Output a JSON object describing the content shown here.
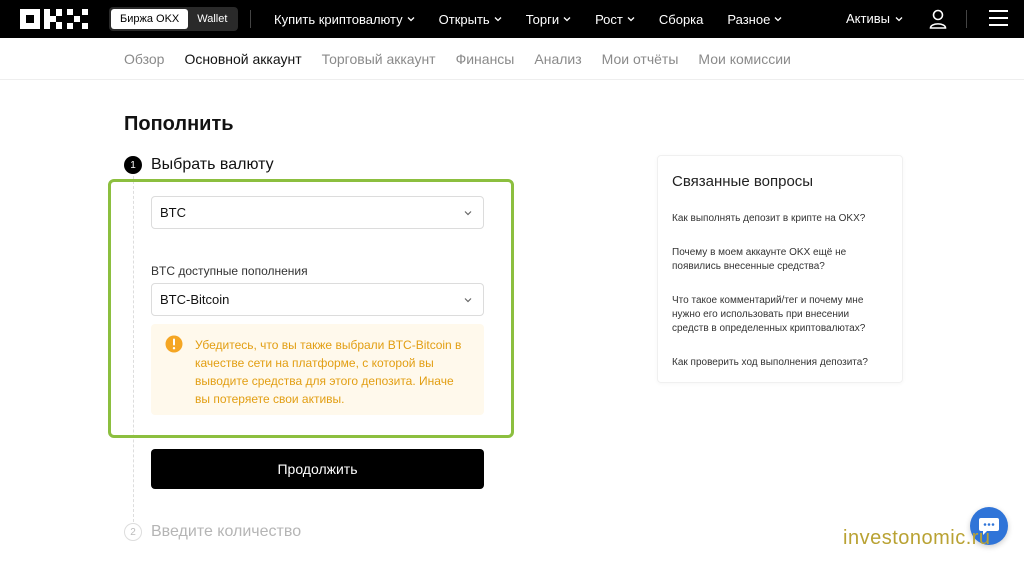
{
  "topbar": {
    "exchange_tab": "Биржа OKX",
    "wallet_tab": "Wallet",
    "menu": [
      {
        "label": "Купить криптовалюту"
      },
      {
        "label": "Открыть"
      },
      {
        "label": "Торги"
      },
      {
        "label": "Рост"
      },
      {
        "label": "Сборка"
      },
      {
        "label": "Разное"
      }
    ],
    "assets": "Активы"
  },
  "subnav": [
    "Обзор",
    "Основной аккаунт",
    "Торговый аккаунт",
    "Финансы",
    "Анализ",
    "Мои отчёты",
    "Мои комиссии"
  ],
  "main": {
    "title": "Пополнить",
    "step1": {
      "num": "1",
      "title": "Выбрать валюту"
    },
    "currency_value": "BTC",
    "network_label": "BTC доступные пополнения",
    "network_value": "BTC-Bitcoin",
    "notice": "Убедитесь, что вы также выбрали BTC-Bitcoin в качестве сети на платформе, с которой вы выводите средства для этого депозита. Иначе вы потеряете свои активы.",
    "continue": "Продолжить",
    "step2": {
      "num": "2",
      "title": "Введите количество"
    }
  },
  "related": {
    "title": "Связанные вопросы",
    "links": [
      "Как выполнять депозит в крипте на OKX?",
      "Почему в моем аккаунте OKX ещё не появились внесенные средства?",
      "Что такое комментарий/тег и почему мне нужно его использовать при внесении средств в определенных криптовалютах?",
      "Как проверить ход выполнения депозита?"
    ]
  },
  "watermark": "investonomic.ru",
  "colors": {
    "highlight": "#8cbf3f",
    "notice_text": "#e29e12",
    "chat": "#2f74d8"
  },
  "icons": [
    "okx-logo",
    "chevron-down-icon",
    "user-icon",
    "menu-icon",
    "warning-icon",
    "chat-icon"
  ]
}
